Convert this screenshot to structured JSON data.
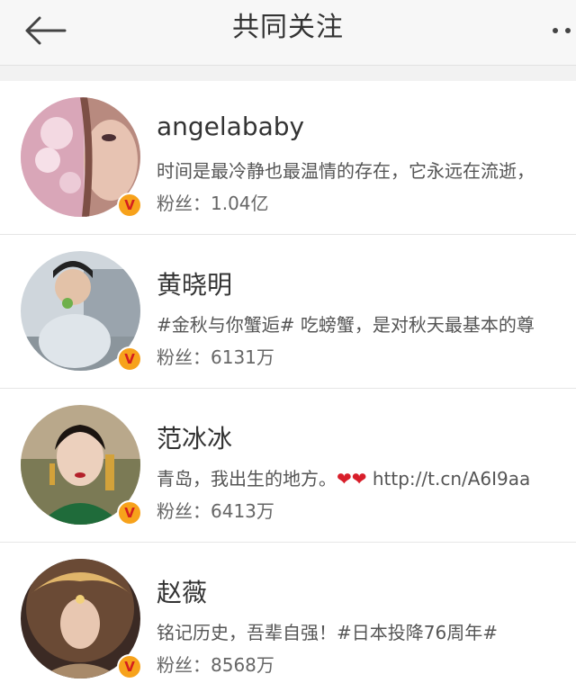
{
  "header": {
    "title": "共同关注"
  },
  "users": [
    {
      "name": "angelababy",
      "description": "时间是最冷静也最温情的存在，它永远在流逝，",
      "fans_label": "粉丝：",
      "fans_count": "1.04亿",
      "verified_badge": "V"
    },
    {
      "name": "黄晓明",
      "description": "#金秋与你蟹逅# 吃螃蟹，是对秋天最基本的尊",
      "fans_label": "粉丝：",
      "fans_count": "6131万",
      "verified_badge": "V"
    },
    {
      "name": "范冰冰",
      "description_prefix": "青岛，我出生的地方。",
      "description_hearts": "❤❤",
      "description_link": " http://t.cn/A6I9aa",
      "fans_label": "粉丝：",
      "fans_count": "6413万",
      "verified_badge": "V"
    },
    {
      "name": "赵薇",
      "description": "铭记历史，吾辈自强！#日本投降76周年#",
      "fans_label": "粉丝：",
      "fans_count": "8568万",
      "verified_badge": "V"
    }
  ],
  "colors": {
    "header_bg": "#f7f7f7",
    "badge_bg": "#f7a21b",
    "badge_text": "#d41f1f",
    "heart": "#d81e2a"
  },
  "icons": {
    "back": "arrow-left-icon",
    "more": "more-dots-icon",
    "verified": "verified-v-icon"
  }
}
